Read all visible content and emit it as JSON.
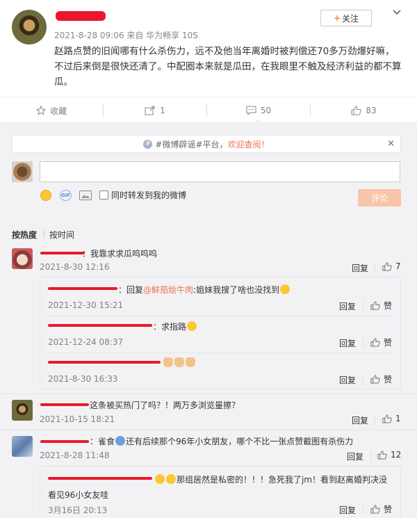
{
  "post": {
    "timestamp": "2021-8-28 09:06",
    "source_prefix": "来自",
    "source": "华为畅享 10S",
    "text": "赵路点赞的旧闻哪有什么杀伤力，远不及他当年离婚时被判偿还70多万劲爆好嘛，不过后来倒是很快还清了。中配圈本来就是瓜田，在我眼里不触及经济利益的都不算瓜。",
    "follow_label": "关注"
  },
  "actions": {
    "favorite_label": "收藏",
    "repost_count": "1",
    "comment_count": "50",
    "like_count": "83"
  },
  "notice": {
    "prefix": "#微博辟谣#平台，",
    "link": "欢迎查阅！",
    "close": "×"
  },
  "composer": {
    "placeholder": "",
    "repost_checkbox_label": "同时转发到我的微博",
    "submit_label": "评论"
  },
  "sort": {
    "by_hot": "按热度",
    "by_time": "按时间"
  },
  "comments": [
    {
      "text": "：我靠求求瓜呜呜呜",
      "time": "2021-8-30 12:16",
      "reply": "回复",
      "likes": "7",
      "replies": [
        {
          "text_prefix": "：回复",
          "mention": "@鲜茄烩牛肉",
          "text": ":姐妹我搜了啥也没找到",
          "time": "2021-12-30 15:21",
          "reply": "回复",
          "like": "赞"
        },
        {
          "text": "：求指路",
          "time": "2021-12-24 08:37",
          "reply": "回复",
          "like": "赞"
        },
        {
          "text": "",
          "time": "2021-8-30 16:33",
          "reply": "回复",
          "like": "赞"
        }
      ]
    },
    {
      "text": "这条被买热门了吗？！两万多浏览量擦？",
      "time": "2021-10-15 18:21",
      "reply": "回复",
      "likes": "1"
    },
    {
      "text_a": "：雀食",
      "text_b": "还有后续那个96年小女朋友，哪个不比一张点赞截图有杀伤力",
      "time": "2021-8-28 11:48",
      "reply": "回复",
      "likes": "12",
      "replies": [
        {
          "text": "那组居然是私密的！！！急死我了jm！看到赵离婚判决没",
          "text2": "看见96小女友哇",
          "time": "3月16日 20:13",
          "reply": "回复",
          "like": "赞"
        }
      ]
    }
  ],
  "colors": {
    "accent": "#eb7350",
    "redaction": "#e8192c",
    "submit_disabled": "#f7c6aa"
  }
}
